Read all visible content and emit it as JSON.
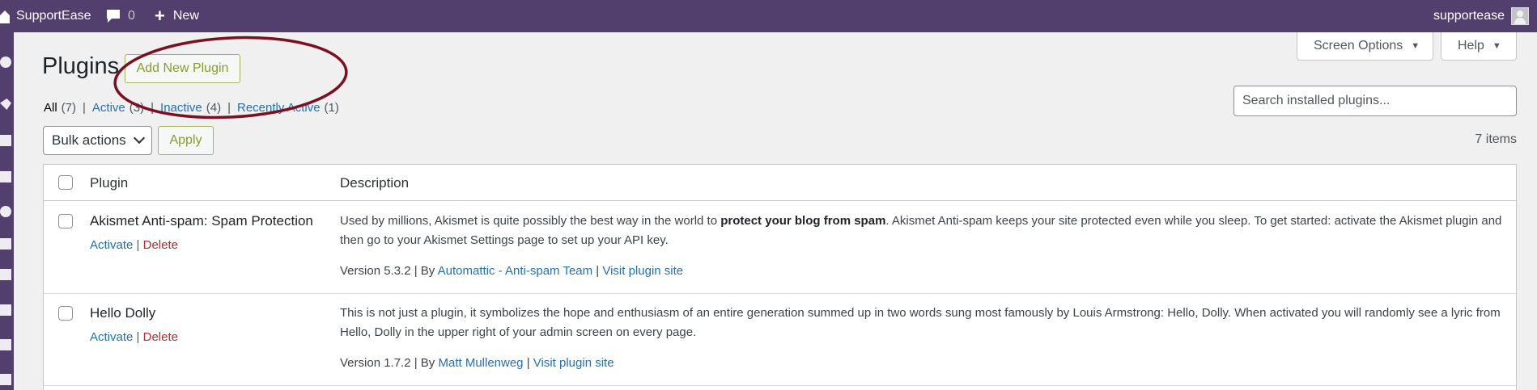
{
  "admin_bar": {
    "site_name": "SupportEase",
    "comments_count": "0",
    "new_label": "New",
    "account_name": "supportease"
  },
  "screen_meta": {
    "screen_options_label": "Screen Options",
    "help_label": "Help"
  },
  "page": {
    "title": "Plugins",
    "add_new_label": "Add New Plugin"
  },
  "filters": [
    {
      "label": "All",
      "count": "(7)"
    },
    {
      "label": "Active",
      "count": "(3)"
    },
    {
      "label": "Inactive",
      "count": "(4)"
    },
    {
      "label": "Recently Active",
      "count": "(1)"
    }
  ],
  "separator": "|",
  "search": {
    "placeholder": "Search installed plugins..."
  },
  "bulk": {
    "selected": "Bulk actions",
    "apply_label": "Apply"
  },
  "items_count": "7 items",
  "table": {
    "col_plugin": "Plugin",
    "col_description": "Description",
    "rows": [
      {
        "name": "Akismet Anti-spam: Spam Protection",
        "activate": "Activate",
        "delete": "Delete",
        "desc_before": "Used by millions, Akismet is quite possibly the best way in the world to ",
        "desc_strong": "protect your blog from spam",
        "desc_after": ". Akismet Anti-spam keeps your site protected even while you sleep. To get started: activate the Akismet plugin and then go to your Akismet Settings page to set up your API key.",
        "version": "Version 5.3.2",
        "by": "By",
        "author": "Automattic - Anti-spam Team",
        "site_link": "Visit plugin site"
      },
      {
        "name": "Hello Dolly",
        "activate": "Activate",
        "delete": "Delete",
        "desc_before": "This is not just a plugin, it symbolizes the hope and enthusiasm of an entire generation summed up in two words sung most famously by Louis Armstrong: Hello, Dolly. When activated you will randomly see a lyric from Hello, Dolly in the upper right of your admin screen on every page.",
        "desc_strong": "",
        "desc_after": "",
        "version": "Version 1.7.2",
        "by": "By",
        "author": "Matt Mullenweg",
        "site_link": "Visit plugin site"
      }
    ]
  },
  "colors": {
    "admin_bar": "#523f6d",
    "link": "#2271b1",
    "delete": "#b32d2e",
    "annotation": "#7a1020"
  }
}
